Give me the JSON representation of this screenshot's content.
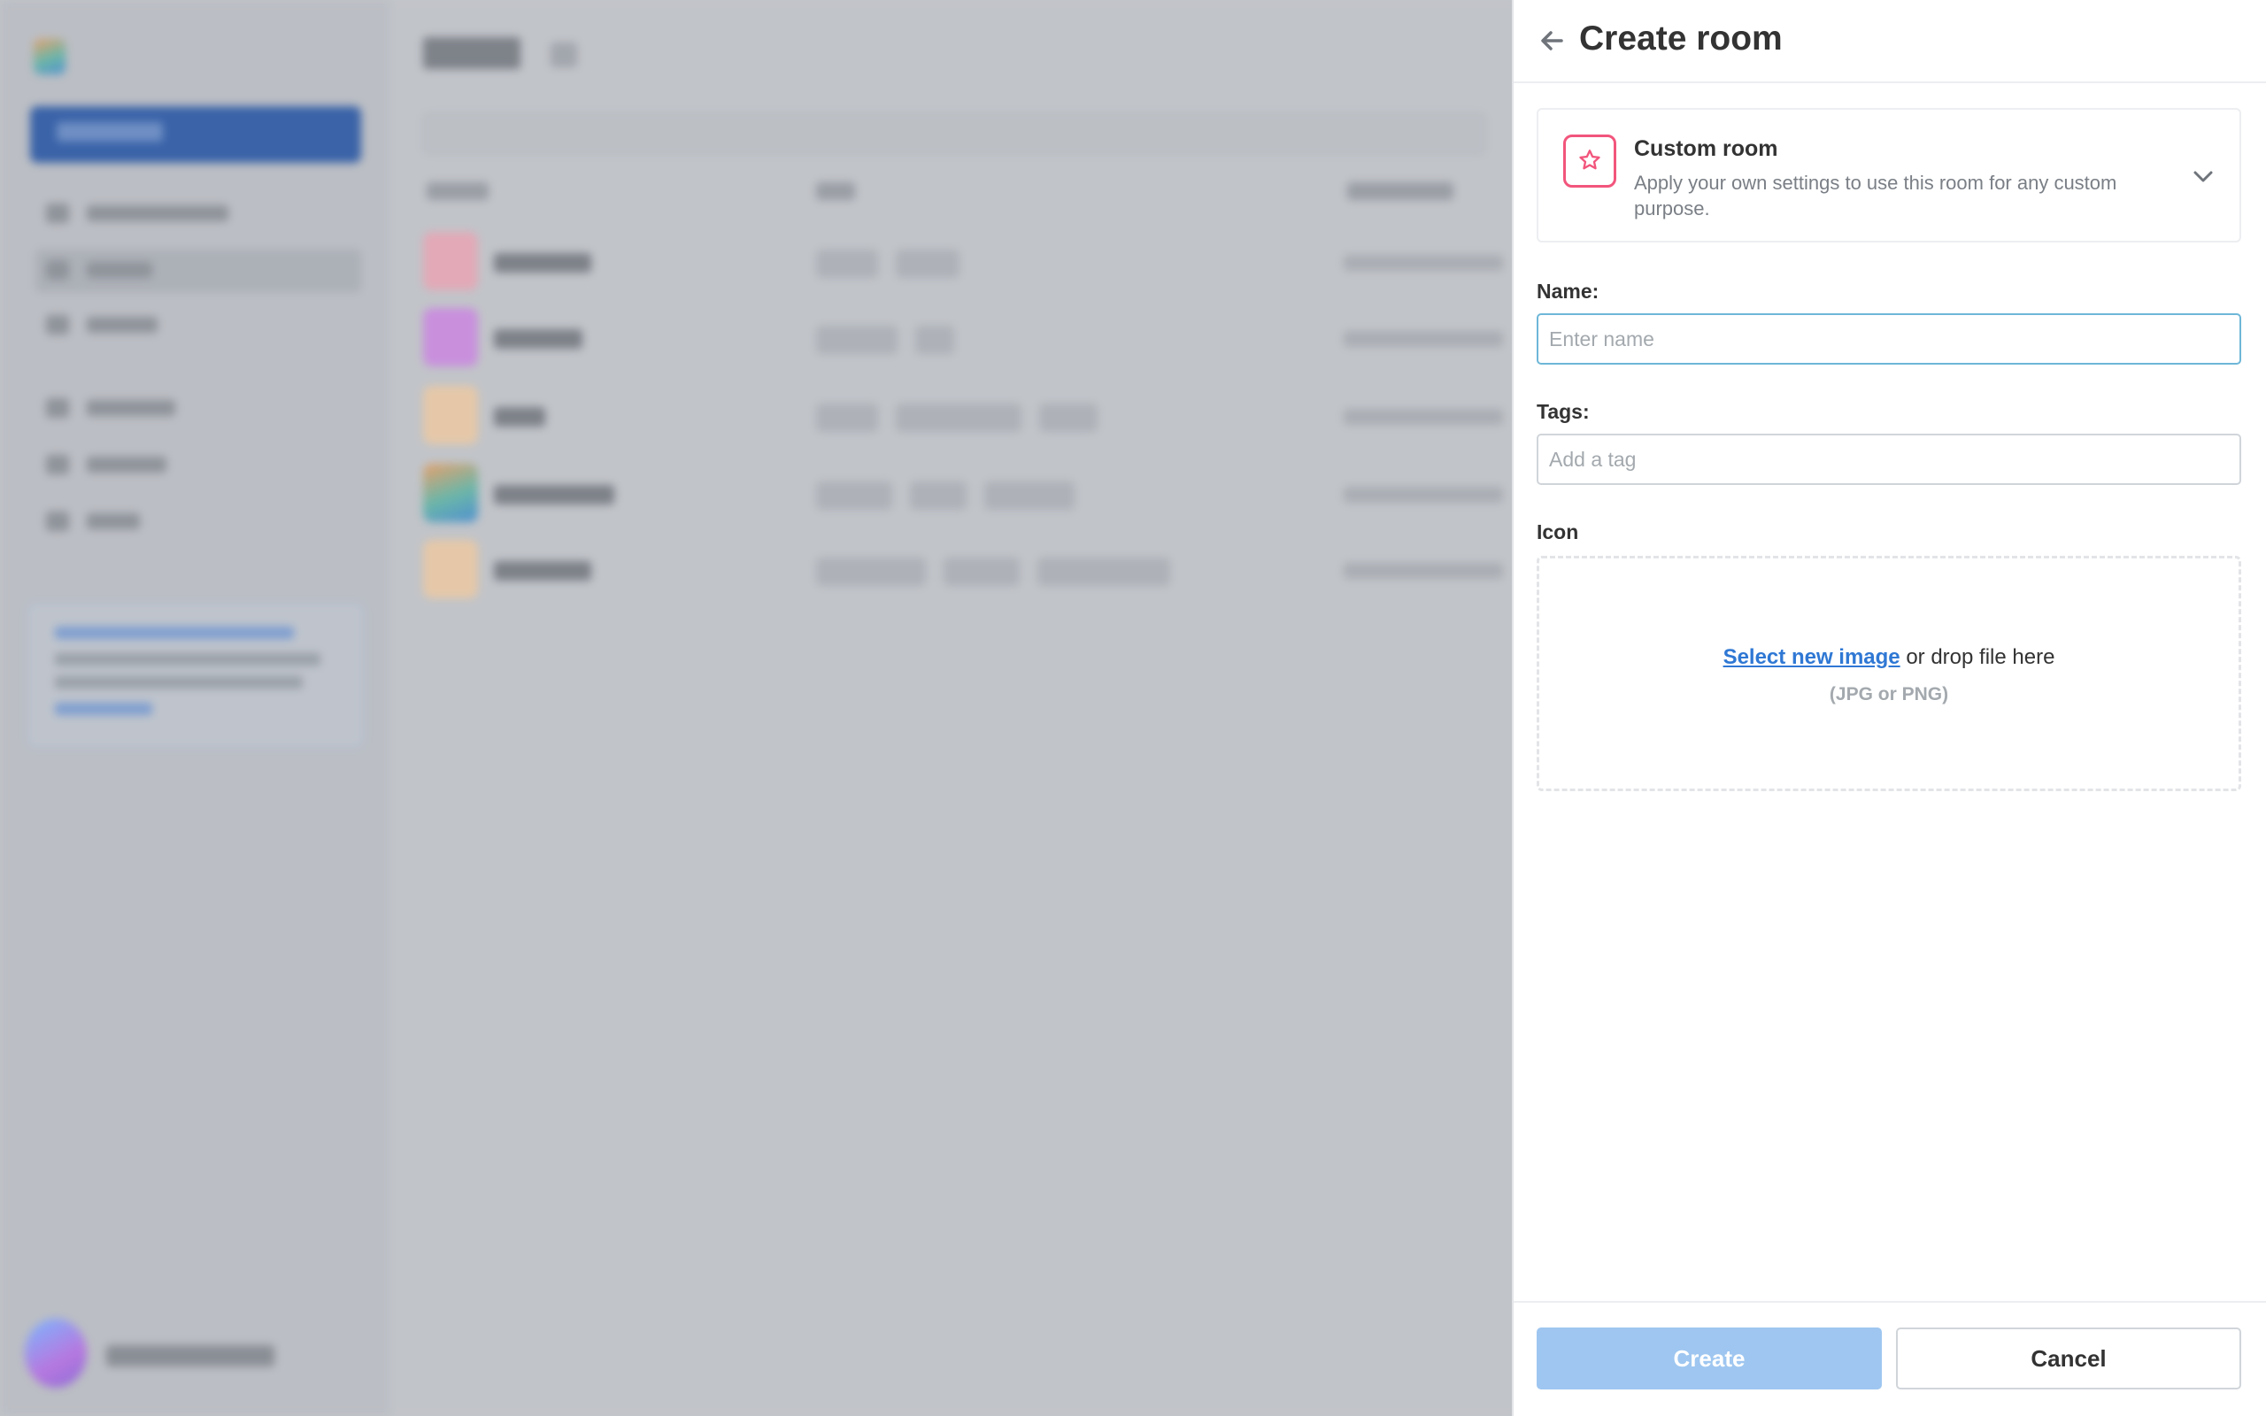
{
  "panel": {
    "title": "Create room",
    "room_type": {
      "title": "Custom room",
      "description": "Apply your own settings to use this room for any custom purpose."
    },
    "name_field": {
      "label": "Name:",
      "placeholder": "Enter name",
      "value": ""
    },
    "tags_field": {
      "label": "Tags:",
      "placeholder": "Add a tag",
      "value": ""
    },
    "icon_section": {
      "label": "Icon",
      "select_link": "Select new image",
      "drop_text": " or drop file here",
      "hint": "(JPG or PNG)"
    },
    "buttons": {
      "create": "Create",
      "cancel": "Cancel"
    }
  },
  "colors": {
    "accent_pink": "#f2557c",
    "link_blue": "#2f78d4",
    "create_disabled": "#9ec6f0",
    "focus_border": "#6eb7d8"
  },
  "icons": {
    "back": "arrow-left-icon",
    "room_type": "star-icon",
    "expand": "chevron-down-icon"
  }
}
